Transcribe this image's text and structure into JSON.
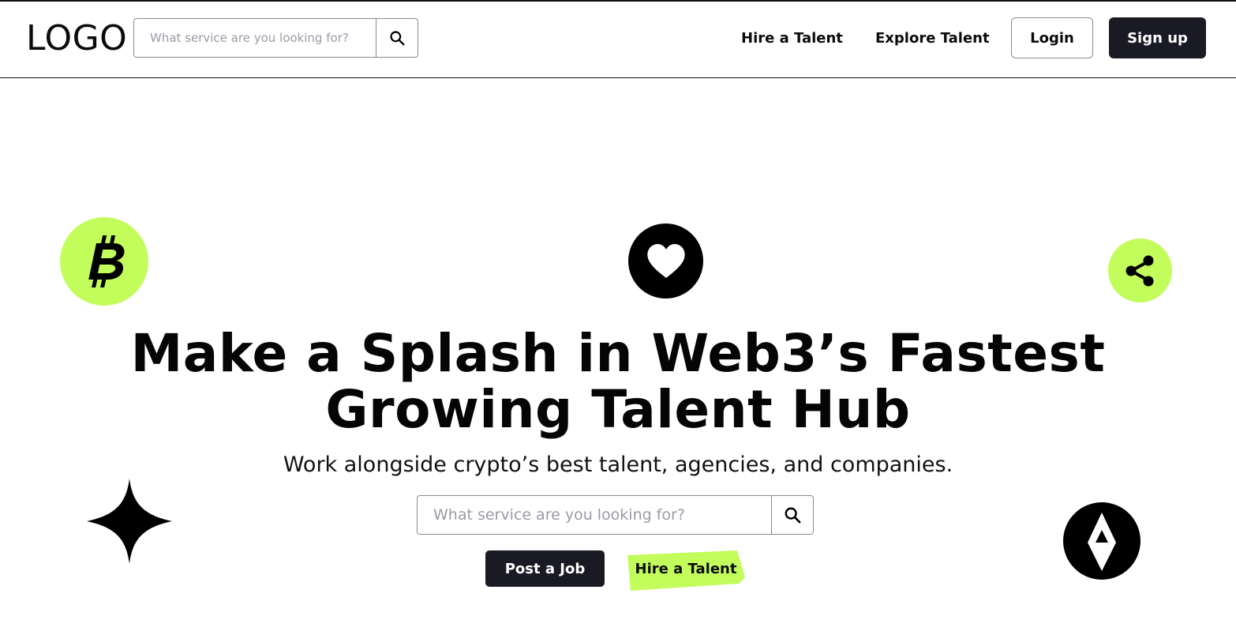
{
  "header": {
    "logo": "LOGO",
    "search_placeholder": "What service are you looking for?",
    "nav": {
      "hire": "Hire a Talent",
      "explore": "Explore Talent"
    },
    "login_label": "Login",
    "signup_label": "Sign up"
  },
  "hero": {
    "title_line1": "Make a Splash in Web3’s Fastest",
    "title_line2": "Growing Talent Hub",
    "subtitle": "Work alongside crypto’s best talent, agencies, and companies.",
    "search_placeholder": "What service are you looking for?",
    "post_job_label": "Post a Job",
    "hire_talent_label": "Hire a Talent"
  },
  "decorations": {
    "icons": [
      "bitcoin-icon",
      "heart-icon",
      "share-icon",
      "sparkle-star-icon",
      "ethereum-icon"
    ]
  },
  "colors": {
    "accent_green": "#c3fd5c",
    "dark_button": "#1a1a24",
    "black": "#000000"
  }
}
